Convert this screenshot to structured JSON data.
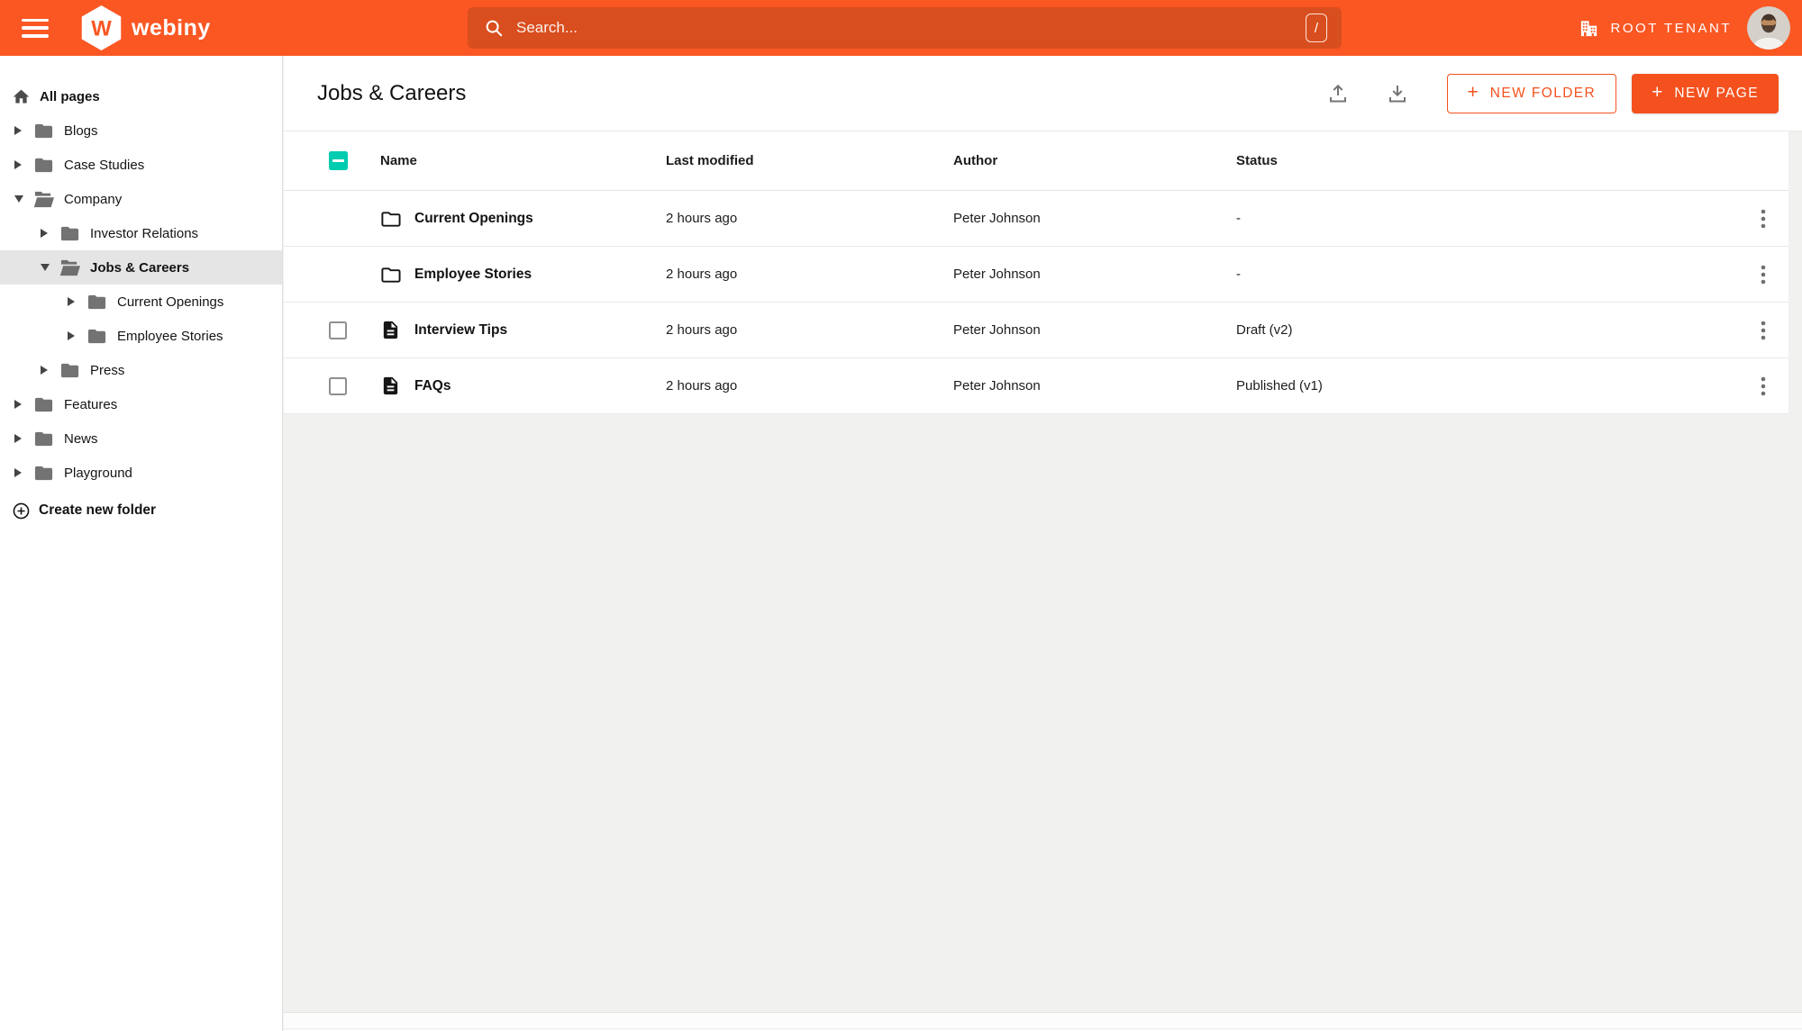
{
  "colors": {
    "topbar": "#fa5723",
    "search_bar": "#d94e1e",
    "primary_button": "#f4511e",
    "checkbox_selected": "#00ccb0",
    "sidebar_selected_bg": "#e5e5e5"
  },
  "icons": {
    "hamburger": "menu",
    "logo": "webiny-hexagon-w",
    "search": "magnifier",
    "shortcut_key": "/",
    "tenant": "building",
    "tree_collapsed": "triangle-right",
    "tree_expanded": "triangle-down",
    "row_menu": "vertical-dots",
    "export": "upload-tray",
    "import": "download-tray"
  },
  "topbar": {
    "brand": "webiny",
    "logo_letter": "W",
    "search": {
      "placeholder": "Search...",
      "shortcut": "/"
    },
    "tenant": "ROOT TENANT"
  },
  "sidebar": {
    "root_label": "All pages",
    "items": [
      {
        "label": "Blogs",
        "level": 0,
        "state": "collapsed",
        "selected": false
      },
      {
        "label": "Case Studies",
        "level": 0,
        "state": "collapsed",
        "selected": false
      },
      {
        "label": "Company",
        "level": 0,
        "state": "expanded",
        "selected": false
      },
      {
        "label": "Investor Relations",
        "level": 1,
        "state": "collapsed",
        "selected": false
      },
      {
        "label": "Jobs & Careers",
        "level": 1,
        "state": "expanded",
        "selected": true
      },
      {
        "label": "Current Openings",
        "level": 2,
        "state": "collapsed",
        "selected": false
      },
      {
        "label": "Employee Stories",
        "level": 2,
        "state": "collapsed",
        "selected": false
      },
      {
        "label": "Press",
        "level": 1,
        "state": "collapsed",
        "selected": false
      },
      {
        "label": "Features",
        "level": 0,
        "state": "collapsed",
        "selected": false
      },
      {
        "label": "News",
        "level": 0,
        "state": "collapsed",
        "selected": false
      },
      {
        "label": "Playground",
        "level": 0,
        "state": "collapsed",
        "selected": false
      }
    ],
    "create_label": "Create new folder"
  },
  "main": {
    "title": "Jobs & Careers",
    "actions": {
      "plus": "+",
      "new_folder": "NEW FOLDER",
      "new_page": "NEW PAGE"
    },
    "table": {
      "columns": [
        "Name",
        "Last modified",
        "Author",
        "Status"
      ],
      "header_checkbox": "indeterminate",
      "rows": [
        {
          "name": "Current Openings",
          "type": "folder",
          "checkbox": "none",
          "modified": "2 hours ago",
          "author": "Peter Johnson",
          "status": "-"
        },
        {
          "name": "Employee Stories",
          "type": "folder",
          "checkbox": "none",
          "modified": "2 hours ago",
          "author": "Peter Johnson",
          "status": "-"
        },
        {
          "name": "Interview Tips",
          "type": "page",
          "checkbox": "unchecked",
          "modified": "2 hours ago",
          "author": "Peter Johnson",
          "status": "Draft (v2)"
        },
        {
          "name": "FAQs",
          "type": "page",
          "checkbox": "unchecked",
          "modified": "2 hours ago",
          "author": "Peter Johnson",
          "status": "Published (v1)"
        }
      ]
    }
  }
}
